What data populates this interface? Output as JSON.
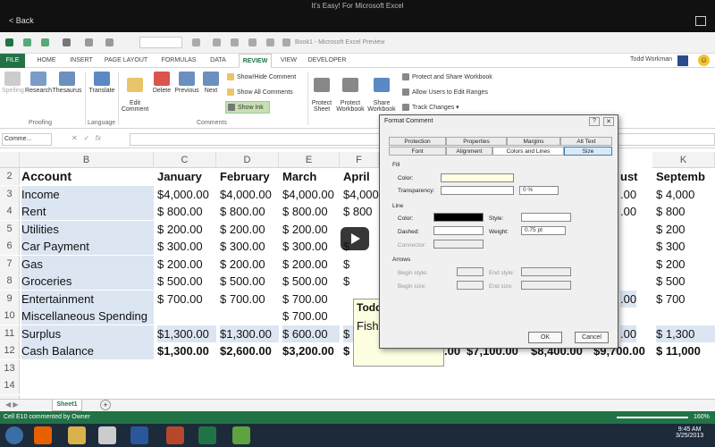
{
  "window": {
    "title": "It's Easy! For Microsoft Excel",
    "back_label": "< Back"
  },
  "qat": {
    "doc_title": "Book1 - Microsoft Excel Preview"
  },
  "tabs": [
    "FILE",
    "HOME",
    "INSERT",
    "PAGE LAYOUT",
    "FORMULAS",
    "DATA",
    "REVIEW",
    "VIEW",
    "DEVELOPER"
  ],
  "user": {
    "name": "Todd Workman"
  },
  "ribbon": {
    "spelling": "Spelling",
    "research": "Research",
    "thesaurus": "Thesaurus",
    "translate": "Translate",
    "edit_comment": "Edit\nComment",
    "delete": "Delete",
    "previous": "Previous",
    "next": "Next",
    "show_hide": "Show/Hide Comment",
    "show_all": "Show All Comments",
    "show_ink": "Show Ink",
    "protect_sheet": "Protect\nSheet",
    "protect_workbook": "Protect\nWorkbook",
    "share_workbook": "Share\nWorkbook",
    "protect_share": "Protect and Share Workbook",
    "allow_users": "Allow Users to Edit Ranges",
    "track_changes": "Track Changes",
    "group_proofing": "Proofing",
    "group_language": "Language",
    "group_comments": "Comments"
  },
  "formula_bar": {
    "name_box": "Comme...",
    "fx": "fx"
  },
  "columns": [
    "B",
    "C",
    "D",
    "E",
    "F",
    "K"
  ],
  "rows": [
    {
      "n": "2",
      "label": "Account",
      "c": "January",
      "d": "February",
      "e": "March",
      "f": "April",
      "k": "Septemb"
    },
    {
      "n": "3",
      "label": "Income",
      "c": "$4,000.00",
      "d": "$4,000.00",
      "e": "$4,000.00",
      "f": "$4,000.00",
      "k": "$   4,000"
    },
    {
      "n": "4",
      "label": "Rent",
      "c": "$   800.00",
      "d": "$   800.00",
      "e": "$   800.00",
      "f": "$   800",
      "k": "$     800"
    },
    {
      "n": "5",
      "label": "Utilities",
      "c": "$   200.00",
      "d": "$   200.00",
      "e": "$   200.00",
      "f": "",
      "k": "$     200"
    },
    {
      "n": "6",
      "label": "Car Payment",
      "c": "$   300.00",
      "d": "$   300.00",
      "e": "$   300.00",
      "f": "$",
      "k": "$     300"
    },
    {
      "n": "7",
      "label": "Gas",
      "c": "$   200.00",
      "d": "$   200.00",
      "e": "$   200.00",
      "f": "$",
      "k": "$     200"
    },
    {
      "n": "8",
      "label": "Groceries",
      "c": "$   500.00",
      "d": "$   500.00",
      "e": "$   500.00",
      "f": "$",
      "k": "$     500"
    },
    {
      "n": "9",
      "label": "Entertainment",
      "c": "$   700.00",
      "d": "$   700.00",
      "e": "$   700.00",
      "f": "",
      "k": "$     700"
    },
    {
      "n": "10",
      "label": "Miscellaneous Spending",
      "c": "",
      "d": "",
      "e": "$   700.00",
      "f": "",
      "k": ""
    },
    {
      "n": "11",
      "label": "Surplus",
      "c": "$1,300.00",
      "d": "$1,300.00",
      "e": "$   600.00",
      "f": "$",
      "k": "$   1,300"
    },
    {
      "n": "12",
      "label": "Cash Balance",
      "c": "$1,300.00",
      "d": "$2,600.00",
      "e": "$3,200.00",
      "f": "$",
      "k": "$  11,000"
    },
    {
      "n": "13",
      "label": "",
      "c": "",
      "d": "",
      "e": "",
      "f": "",
      "k": ""
    },
    {
      "n": "14",
      "label": "",
      "c": "",
      "d": "",
      "e": "",
      "f": "",
      "k": ""
    },
    {
      "n": "15",
      "label": "",
      "c": "",
      "d": "",
      "e": "",
      "f": "",
      "k": ""
    }
  ],
  "hidden_cols": {
    "i2": "ust",
    "r12": [
      ".00",
      "$7,100.00",
      "$8,400.00",
      "$9,700.00"
    ],
    "r11": ".00",
    "r3": ".00",
    "r4": ".00",
    "r9": ".00"
  },
  "comment": {
    "author": "Todd",
    "text": "Fishi"
  },
  "dialog": {
    "title": "Format Comment",
    "tabs_top": [
      "Protection",
      "Properties",
      "Margins",
      "Alt Text"
    ],
    "tabs_bottom": [
      "Font",
      "Alignment",
      "Colors and Lines",
      "Size"
    ],
    "fill": "Fill",
    "color": "Color:",
    "transparency": "Transparency:",
    "transparency_value": "0 %",
    "line": "Line",
    "line_color": "Color:",
    "dashed": "Dashed:",
    "connector": "Connector:",
    "style": "Style:",
    "weight": "Weight:",
    "weight_value": "0.75 pt",
    "arrows": "Arrows",
    "begin_style": "Begin style:",
    "end_style": "End style:",
    "begin_size": "Begin size:",
    "end_size": "End size:",
    "ok": "OK",
    "cancel": "Cancel"
  },
  "sheet": {
    "tab": "Sheet1",
    "add": "+"
  },
  "status": {
    "text": "Cell E10 commented by Owner",
    "zoom": "160%"
  },
  "clock": {
    "time": "9:45 AM",
    "date": "3/25/2013"
  }
}
